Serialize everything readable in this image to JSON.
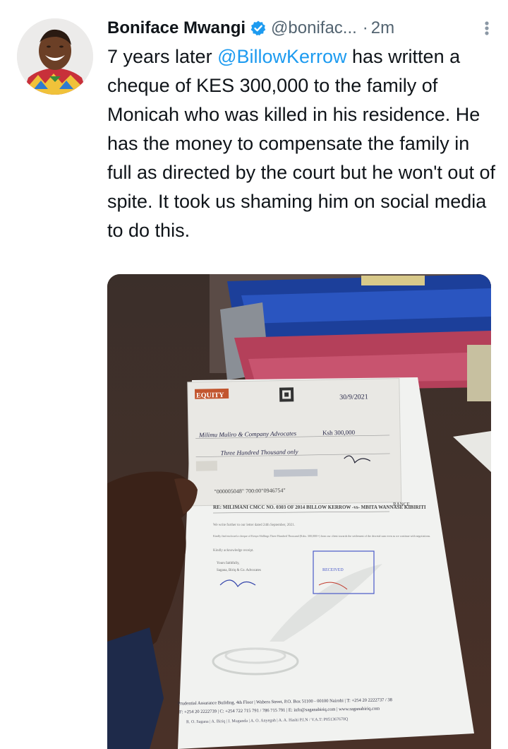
{
  "tweet": {
    "author_name": "Boniface Mwangi",
    "author_handle": "@bonifac...",
    "time_sep": "·",
    "time": "2m",
    "more_icon": "more-vertical-icon",
    "verified_icon": "verified-badge-icon",
    "text_before": "7 years later ",
    "mention": "@BillowKerrow",
    "text_after": " has written a cheque of KES 300,000 to the family of Monicah who was killed in his residence. He has the money to compensate the family in full as directed by the court but he won't out of spite. It took us shaming him on social media to do this.",
    "colors": {
      "link": "#1d9bf0",
      "verified": "#1d9bf0",
      "muted": "#536471"
    }
  },
  "photo": {
    "cheque": {
      "bank": "EQUITY",
      "date": "30/9/2021",
      "amount": "Ksh 300,000",
      "payee": "Milimu Muliro & Company Advocates",
      "words": "Three Hundred Thousand only",
      "micr": "\"000005048\" 700:00\"0946754\""
    },
    "letter": {
      "re_line": "RE:  MILIMANI CMCC NO. 0303 OF 2014  BILLOW KERROW -vs- MBITA WANNASE KIBIRITI",
      "ref": "RANCE",
      "body1": "We write further to our letter dated 24th September, 2021.",
      "body2": "Kindly find enclosed a cheque of Kenya Shillings Three Hundred Thousand (Kshs. 300,000/=) from our client towards the settlement of the decretal sum even as we continue with negotiations.",
      "body3": "Kindly acknowledge receipt.",
      "sign1": "Yours faithfully,",
      "sign2": "Sagana, Biriq & Co. Advocates",
      "stamp": "RECEIVED",
      "footer1": "Prudential Assurance Building, 4th Floor | Wabera Street, P.O. Box 51100 - 00100 Nairobi | T: +254 20 2222737 / 38",
      "footer2": "F: +254 20 2222739 | C: +254 722 715 791 / 786 715 791 | E: info@saganabiriq.com | www.saganabiriq.com",
      "footer3": "R. O. Sagana | A. Biriq | I. Muganda | A. O. Anyegah | A. A. Hashi          P.I.N / V.A.T: P051367670Q"
    }
  }
}
